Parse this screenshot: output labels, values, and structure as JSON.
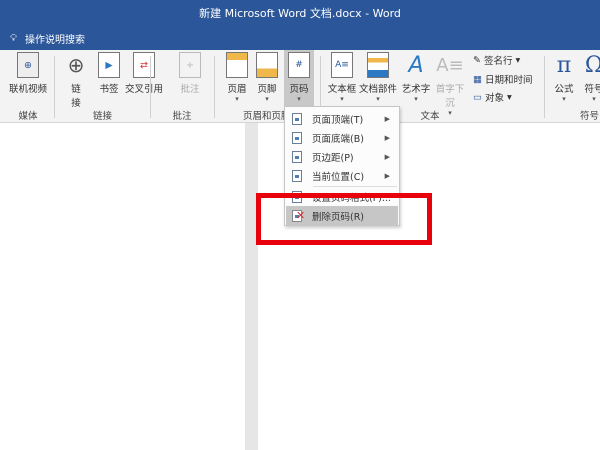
{
  "window": {
    "title": "新建 Microsoft Word 文档.docx  -  Word"
  },
  "search": {
    "label": "操作说明搜索",
    "icon": "lightbulb-icon"
  },
  "ribbon": {
    "buttons": {
      "online_video": "联机视频",
      "link": "链\n接",
      "bookmark": "书签",
      "cross_ref": "交叉引用",
      "comment": "批注",
      "header": "页眉",
      "footer": "页脚",
      "page_number": "页码",
      "textbox": "文本框",
      "quick_parts": "文档部件",
      "wordart": "艺术字",
      "dropcap": "首字下沉",
      "signature": "签名行",
      "datetime": "日期和时间",
      "object": "对象",
      "equation": "公式",
      "symbol": "符号"
    },
    "groups": {
      "media": "媒体",
      "links": "链接",
      "comments": "批注",
      "header_footer": "页眉和页脚",
      "text": "文本",
      "symbols": "符号"
    },
    "arrow": "▾"
  },
  "menu": {
    "items": [
      {
        "label": "页面顶端(T)",
        "submenu": true
      },
      {
        "label": "页面底端(B)",
        "submenu": true
      },
      {
        "label": "页边距(P)",
        "submenu": true
      },
      {
        "label": "当前位置(C)",
        "submenu": true
      },
      {
        "label": "设置页码格式(F)...",
        "submenu": false
      },
      {
        "label": "删除页码(R)",
        "submenu": false,
        "hover": true
      }
    ],
    "submenu_glyph": "▶"
  },
  "colors": {
    "titlebar": "#2b579a",
    "highlight": "#e8000b"
  }
}
